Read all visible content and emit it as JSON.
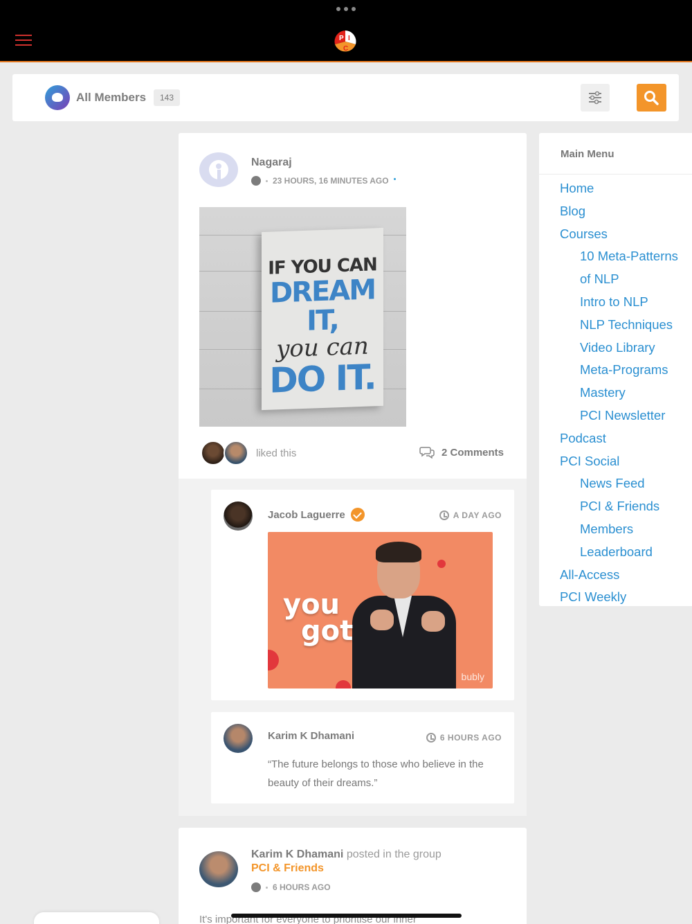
{
  "header": {
    "logo_letters": [
      "P",
      "I",
      "C"
    ],
    "accent_color": "#e97a1f"
  },
  "members_bar": {
    "label": "All Members",
    "count": "143"
  },
  "post": {
    "author": "Nagaraj",
    "time": "23 HOURS, 16 MINUTES AGO",
    "sign": {
      "line1": "IF YOU CAN",
      "line2": "DREAM IT,",
      "line3": "you can",
      "line4": "DO IT."
    },
    "likes_text": "liked this",
    "comments_label": "2 Comments",
    "comments": [
      {
        "name": "Jacob Laguerre",
        "time": "A DAY AGO",
        "gif_text_1": "you",
        "gif_text_2": "got",
        "gif_watermark": "bubly"
      },
      {
        "name": "Karim K Dhamani",
        "time": "6 HOURS AGO",
        "text": "“The future belongs to those who believe in the beauty of their dreams.”"
      }
    ]
  },
  "post2": {
    "author": "Karim K Dhamani",
    "action": " posted in the group",
    "group": "PCI & Friends",
    "time": "6 HOURS AGO",
    "excerpt": "It's important for everyone to prioritise our inner"
  },
  "side_menu": {
    "title": "Main Menu",
    "items": [
      {
        "label": "Home",
        "level": 0
      },
      {
        "label": "Blog",
        "level": 0
      },
      {
        "label": "Courses",
        "level": 0
      },
      {
        "label": "10 Meta-Patterns",
        "level": 1
      },
      {
        "label": "of NLP",
        "level": 1
      },
      {
        "label": "Intro to NLP",
        "level": 1
      },
      {
        "label": "NLP Techniques",
        "level": 1
      },
      {
        "label": "Video Library",
        "level": 1
      },
      {
        "label": "Meta-Programs",
        "level": 1
      },
      {
        "label": "Mastery",
        "level": 1
      },
      {
        "label": "PCI Newsletter",
        "level": 1
      },
      {
        "label": "Podcast",
        "level": 0
      },
      {
        "label": "PCI Social",
        "level": 0
      },
      {
        "label": "News Feed",
        "level": 1
      },
      {
        "label": "PCI & Friends",
        "level": 1
      },
      {
        "label": "Members",
        "level": 1
      },
      {
        "label": "Leaderboard",
        "level": 1
      },
      {
        "label": "All-Access",
        "level": 0
      },
      {
        "label": "PCI Weekly",
        "level": 0
      }
    ]
  }
}
